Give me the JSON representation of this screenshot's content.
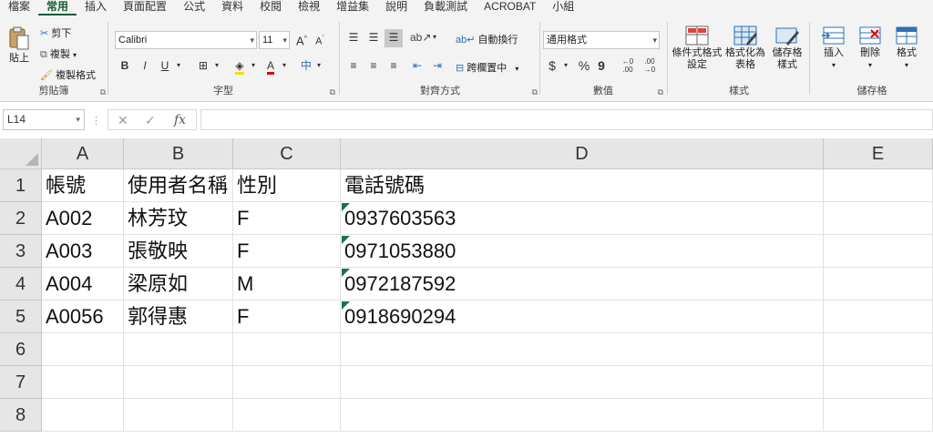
{
  "ribbon_tabs": [
    "檔案",
    "常用",
    "插入",
    "頁面配置",
    "公式",
    "資料",
    "校閱",
    "檢視",
    "增益集",
    "說明",
    "負載測試",
    "ACROBAT",
    "小組"
  ],
  "active_tab": "常用",
  "clipboard": {
    "paste": "貼上",
    "cut": "剪下",
    "copy": "複製",
    "format_painter": "複製格式",
    "title": "剪貼簿"
  },
  "font": {
    "name": "Calibri",
    "size": "11",
    "bold": "B",
    "italic": "I",
    "underline": "U",
    "title": "字型"
  },
  "alignment": {
    "wrap_text": "自動換行",
    "merge_center": "跨欄置中",
    "title": "對齊方式"
  },
  "number": {
    "format": "通用格式",
    "currency": "$",
    "percent": "%",
    "comma": "9",
    "title": "數值"
  },
  "styles": {
    "conditional": "條件式格式\n設定",
    "table": "格式化為\n表格",
    "cell_styles": "儲存格\n樣式",
    "title": "樣式"
  },
  "cells": {
    "insert": "插入",
    "delete": "刪除",
    "format": "格式",
    "title": "儲存格"
  },
  "formula_bar": {
    "name_box": "L14",
    "fx": "fx",
    "formula": ""
  },
  "columns": [
    "A",
    "B",
    "C",
    "D",
    "E"
  ],
  "rows": [
    "1",
    "2",
    "3",
    "4",
    "5",
    "6",
    "7",
    "8"
  ],
  "table": {
    "headers": [
      "帳號",
      "使用者名稱",
      "性別",
      "電話號碼"
    ],
    "data": [
      [
        "A002",
        "林芳玟",
        "F",
        "0937603563"
      ],
      [
        "A003",
        "張敬映",
        "F",
        "0971053880"
      ],
      [
        "A004",
        "梁原如",
        "M",
        "0972187592"
      ],
      [
        "A0056",
        "郭得惠",
        "F",
        "0918690294"
      ]
    ]
  },
  "colors": {
    "accent": "#185c37",
    "error_indicator": "#1e7145"
  }
}
